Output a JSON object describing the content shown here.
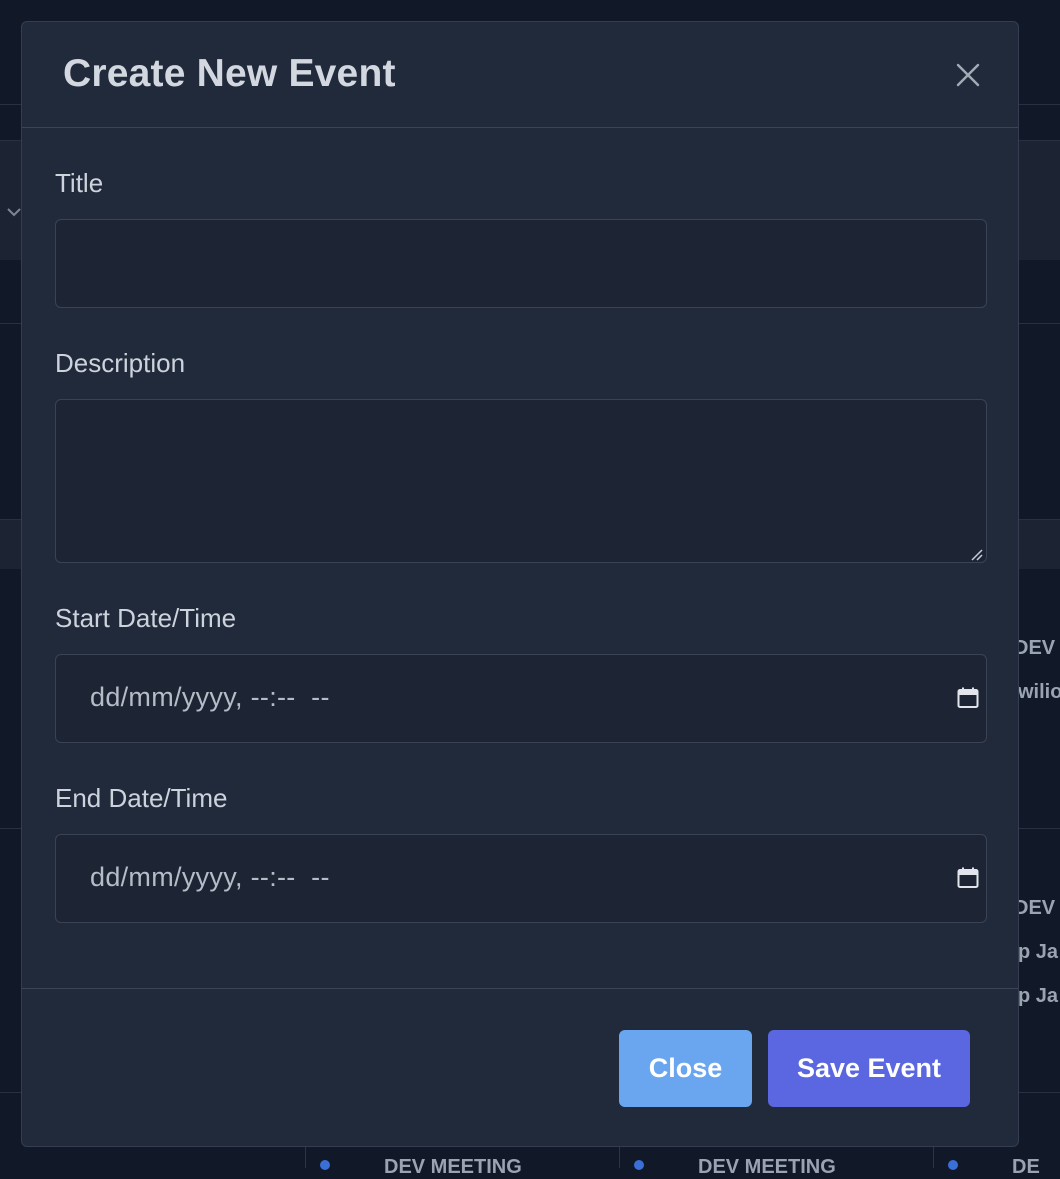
{
  "modal": {
    "title": "Create New Event",
    "close_icon": "close-icon"
  },
  "form": {
    "title_label": "Title",
    "title_value": "",
    "description_label": "Description",
    "description_value": "",
    "start_label": "Start Date/Time",
    "start_value": "dd/mm/yyyy, --:--  --",
    "end_label": "End Date/Time",
    "end_value": "dd/mm/yyyy, --:--  --",
    "calendar_icon": "calendar-icon"
  },
  "footer": {
    "close_label": "Close",
    "save_label": "Save Event"
  },
  "background": {
    "fragments": [
      "DEV",
      "wilio",
      "DEV",
      "p Ja",
      "p Ja",
      "DEV MEETING",
      "DEV MEETING",
      "DE"
    ]
  },
  "colors": {
    "backdrop": "#111827",
    "modal": "#212a3b",
    "close_button": "#6aa6f0",
    "save_button": "#5a67e0"
  }
}
